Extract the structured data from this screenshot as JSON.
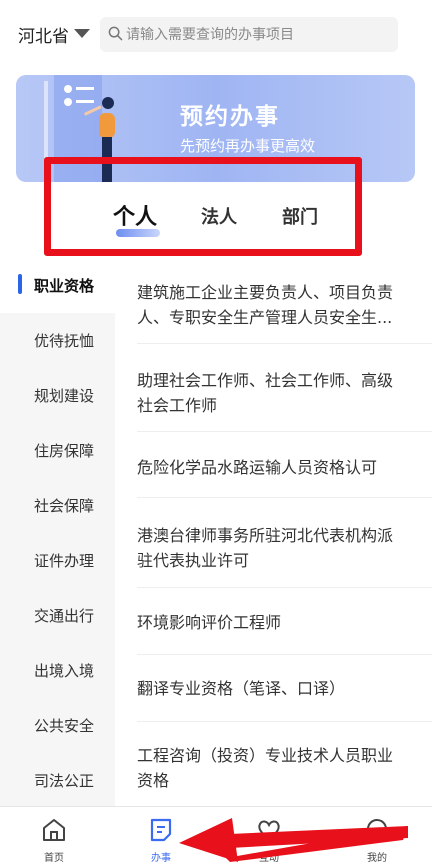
{
  "header": {
    "region": "河北省",
    "search_placeholder": "请输入需要查询的办事项目"
  },
  "banner": {
    "title": "预约办事",
    "subtitle": "先预约再办事更高效"
  },
  "tabs": [
    {
      "label": "个人",
      "active": true
    },
    {
      "label": "法人",
      "active": false
    },
    {
      "label": "部门",
      "active": false
    }
  ],
  "categories": [
    {
      "label": "职业资格",
      "active": true
    },
    {
      "label": "优待抚恤"
    },
    {
      "label": "规划建设"
    },
    {
      "label": "住房保障"
    },
    {
      "label": "社会保障"
    },
    {
      "label": "证件办理"
    },
    {
      "label": "交通出行"
    },
    {
      "label": "出境入境"
    },
    {
      "label": "公共安全"
    },
    {
      "label": "司法公正"
    }
  ],
  "items": [
    {
      "line1": "建筑施工企业主要负责人、项目负责",
      "line2": "人、专职安全生产管理人员安全生..."
    },
    {
      "line1": "助理社会工作师、社会工作师、高级",
      "line2": "社会工作师"
    },
    {
      "line1": "危险化学品水路运输人员资格认可",
      "line2": ""
    },
    {
      "line1": "港澳台律师事务所驻河北代表机构派",
      "line2": "驻代表执业许可"
    },
    {
      "line1": "环境影响评价工程师",
      "line2": ""
    },
    {
      "line1": "翻译专业资格（笔译、口译）",
      "line2": ""
    },
    {
      "line1": "工程咨询（投资）专业技术人员职业",
      "line2": "资格"
    }
  ],
  "bottom_nav": [
    {
      "label": "首页",
      "icon": "home-icon"
    },
    {
      "label": "办事",
      "icon": "document-icon",
      "active": true
    },
    {
      "label": "互动",
      "icon": "heart-icon"
    },
    {
      "label": "我的",
      "icon": "user-icon"
    }
  ],
  "colors": {
    "accent": "#3b6bf0",
    "highlight_red": "#e8101b",
    "banner_blue": "#9fb5f3"
  }
}
